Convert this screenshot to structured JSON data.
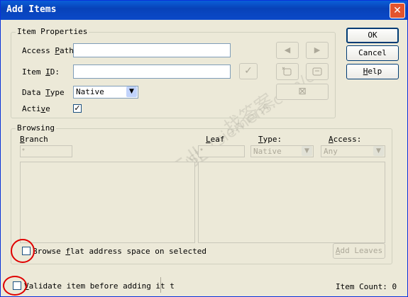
{
  "window": {
    "title": "Add Items",
    "close_glyph": "✕"
  },
  "item_properties": {
    "group_label": "Item Properties",
    "access_path_label_pre": "Access ",
    "access_path_label_u": "P",
    "access_path_label_post": "ath",
    "access_path_value": "",
    "item_id_label_pre": "Item ",
    "item_id_label_u": "I",
    "item_id_label_post": "D:",
    "item_id_value": "",
    "data_type_label_pre": "Data ",
    "data_type_label_u": "T",
    "data_type_label_post": "ype",
    "data_type_value": "Native",
    "active_label_pre": "Acti",
    "active_label_u": "v",
    "active_label_post": "e",
    "active_checked": "✓"
  },
  "side_buttons": {
    "ok": "OK",
    "cancel": "Cancel",
    "help_pre": "",
    "help_u": "H",
    "help_post": "elp"
  },
  "toolbar_icons": {
    "prev": "◀",
    "next": "▶",
    "check": "✓",
    "remove": "⊠"
  },
  "browsing": {
    "group_label": "Browsing",
    "branch_label_u": "B",
    "branch_label_post": "ranch",
    "branch_filter": "*",
    "leaf_label_u": "L",
    "leaf_label_post": "eaf",
    "leaf_filter": "*",
    "type_label_u": "T",
    "type_label_post": "ype:",
    "type_value": "Native",
    "access_label_u": "A",
    "access_label_post": "ccess:",
    "access_value": "Any",
    "browse_flat_pre": "Browse ",
    "browse_flat_u": "f",
    "browse_flat_post": "lat address space on selected",
    "add_leaves_u": "A",
    "add_leaves_post": "dd Leaves"
  },
  "footer": {
    "validate_u": "V",
    "validate_post": "alidate item before adding it t",
    "item_count_label": "Item Count: 0"
  },
  "watermark": {
    "line1": "西门子工业",
    "line2": "support.industry.siemens.com/cs",
    "line3": "找答案"
  },
  "colors": {
    "titlebar": "#0842b8",
    "annotation": "#e00000",
    "face": "#ece9d8"
  }
}
